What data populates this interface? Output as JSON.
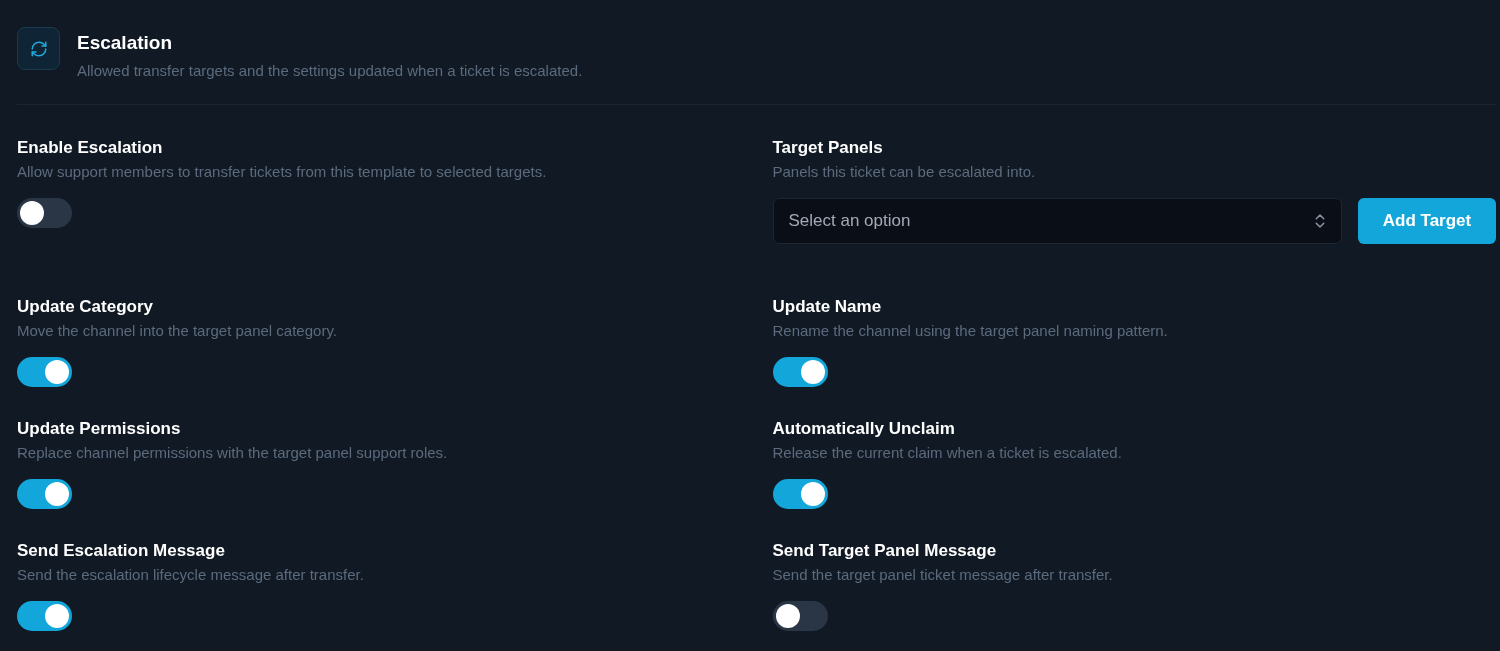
{
  "header": {
    "title": "Escalation",
    "subtitle": "Allowed transfer targets and the settings updated when a ticket is escalated."
  },
  "settings": [
    {
      "kind": "toggle",
      "label": "Enable Escalation",
      "description": "Allow support members to transfer tickets from this template to selected targets.",
      "on": false
    },
    {
      "kind": "select",
      "label": "Target Panels",
      "description": "Panels this ticket can be escalated into.",
      "placeholder": "Select an option",
      "button": "Add Target"
    },
    {
      "kind": "toggle",
      "label": "Update Category",
      "description": "Move the channel into the target panel category.",
      "on": true
    },
    {
      "kind": "toggle",
      "label": "Update Name",
      "description": "Rename the channel using the target panel naming pattern.",
      "on": true
    },
    {
      "kind": "toggle",
      "label": "Update Permissions",
      "description": "Replace channel permissions with the target panel support roles.",
      "on": true
    },
    {
      "kind": "toggle",
      "label": "Automatically Unclaim",
      "description": "Release the current claim when a ticket is escalated.",
      "on": true
    },
    {
      "kind": "toggle",
      "label": "Send Escalation Message",
      "description": "Send the escalation lifecycle message after transfer.",
      "on": true
    },
    {
      "kind": "toggle",
      "label": "Send Target Panel Message",
      "description": "Send the target panel ticket message after transfer.",
      "on": false
    }
  ]
}
